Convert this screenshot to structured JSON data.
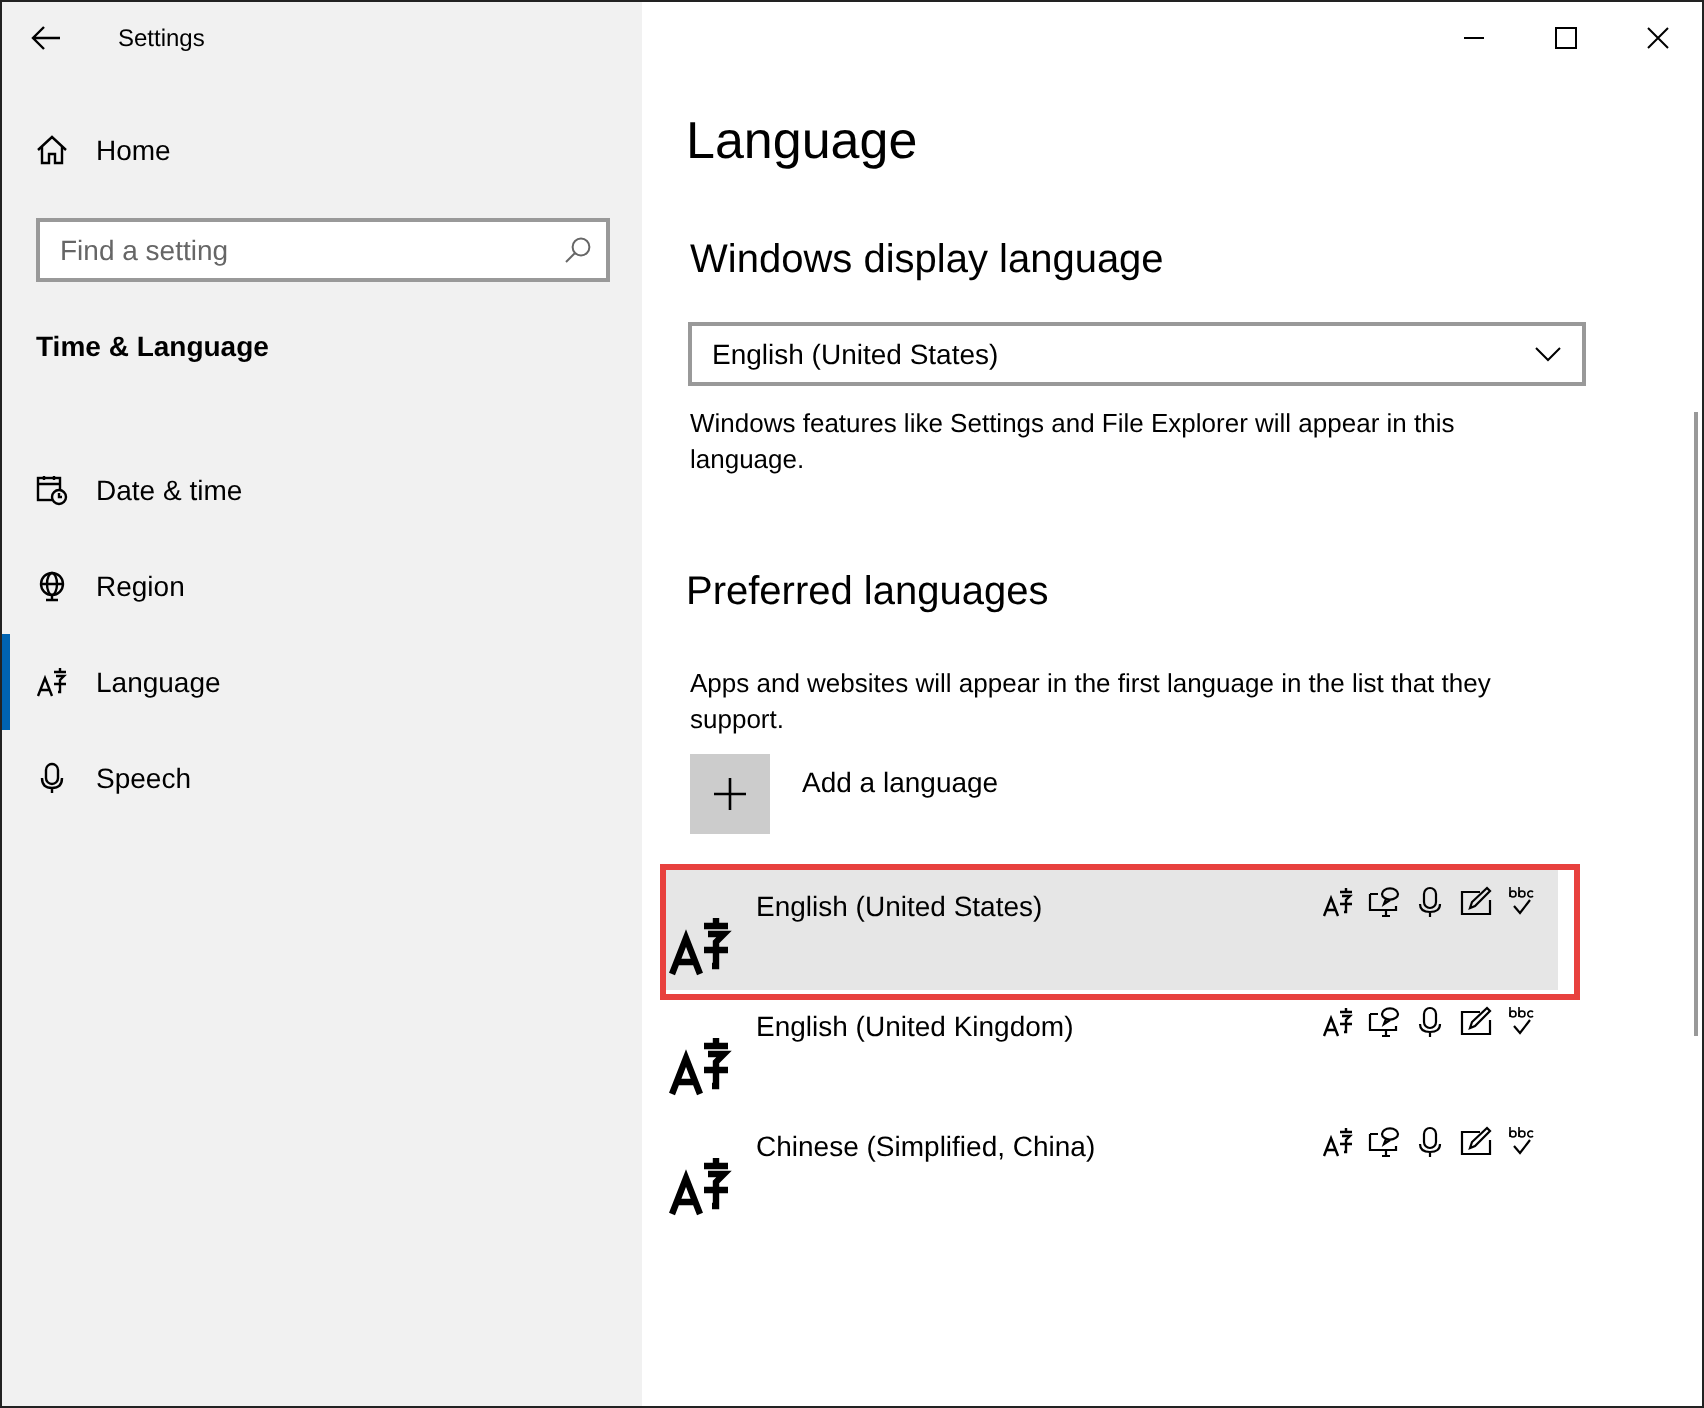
{
  "window": {
    "title": "Settings"
  },
  "sidebar": {
    "home": "Home",
    "search": {
      "placeholder": "Find a setting"
    },
    "section": "Time & Language",
    "items": [
      {
        "label": "Date & time",
        "kind": "datetime",
        "selected": false
      },
      {
        "label": "Region",
        "kind": "region",
        "selected": false
      },
      {
        "label": "Language",
        "kind": "language",
        "selected": true
      },
      {
        "label": "Speech",
        "kind": "speech",
        "selected": false
      }
    ]
  },
  "main": {
    "title": "Language",
    "display_language": {
      "heading": "Windows display language",
      "dropdown": {
        "value": "English (United States)"
      },
      "description": "Windows features like Settings and File Explorer will appear in this language."
    },
    "preferred": {
      "heading": "Preferred languages",
      "description": "Apps and websites will appear in the first language in the list that they support.",
      "add_button": "Add a language",
      "languages": [
        {
          "name": "English (United States)",
          "selected": true,
          "highlighted": true
        },
        {
          "name": "English (United Kingdom)",
          "selected": false,
          "highlighted": false
        },
        {
          "name": "Chinese (Simplified, China)",
          "selected": false,
          "highlighted": false
        }
      ]
    }
  }
}
